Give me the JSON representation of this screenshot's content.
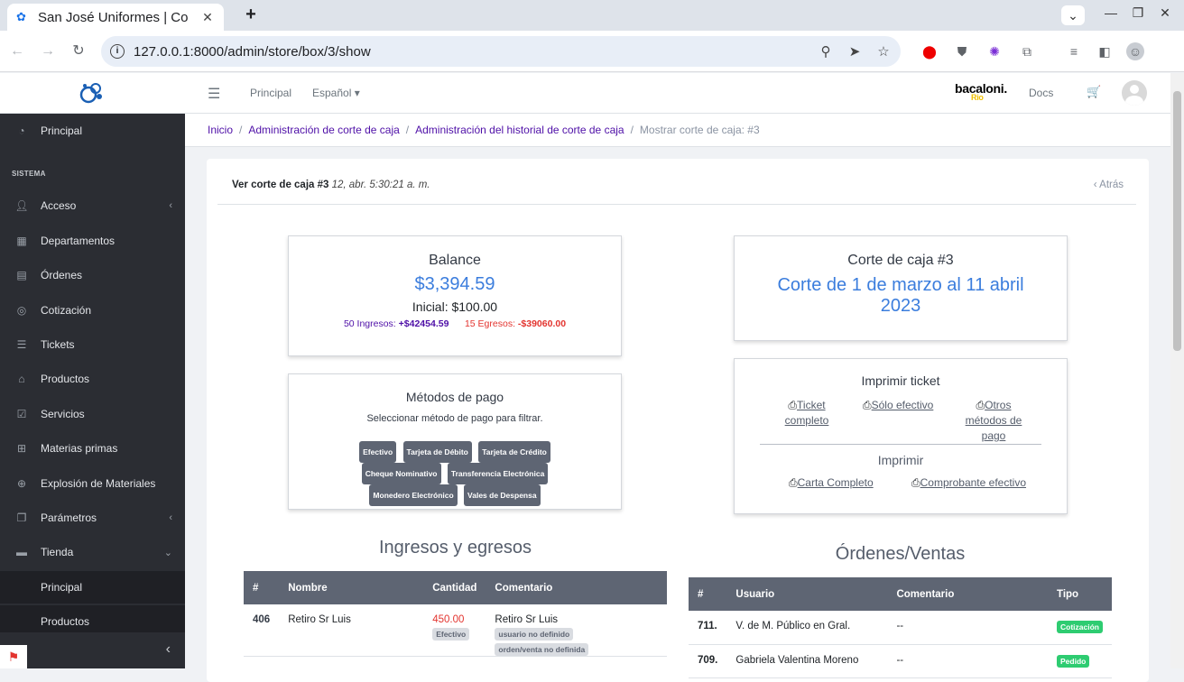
{
  "browser": {
    "tab_title": "San José Uniformes | Co",
    "url": "127.0.0.1:8000/admin/store/box/3/show"
  },
  "header": {
    "nav": [
      "Principal",
      "Español"
    ],
    "brand_name": "bacaloni",
    "brand_sub": "Rio",
    "docs": "Docs"
  },
  "sidebar": {
    "top_item": "Principal",
    "section": "SISTEMA",
    "items": [
      {
        "label": "Acceso",
        "icon": "user-icon",
        "has_arrow": true
      },
      {
        "label": "Departamentos",
        "icon": "grid-icon"
      },
      {
        "label": "Órdenes",
        "icon": "receipt-icon"
      },
      {
        "label": "Cotización",
        "icon": "target-icon"
      },
      {
        "label": "Tickets",
        "icon": "list-icon"
      },
      {
        "label": "Productos",
        "icon": "tag-icon"
      },
      {
        "label": "Servicios",
        "icon": "checklist-icon"
      },
      {
        "label": "Materias primas",
        "icon": "boxes-icon"
      },
      {
        "label": "Explosión de Materiales",
        "icon": "globe-icon"
      },
      {
        "label": "Parámetros",
        "icon": "copy-icon",
        "has_arrow": true
      },
      {
        "label": "Tienda",
        "icon": "store-icon",
        "expanded": true
      }
    ],
    "subitems": [
      "Principal",
      "Productos"
    ]
  },
  "breadcrumb": {
    "items": [
      "Inicio",
      "Administración de corte de caja",
      "Administración del historial de corte de caja"
    ],
    "current": "Mostrar corte de caja: #3"
  },
  "card": {
    "title": "Ver corte de caja #3",
    "date": "12, abr. 5:30:21 a. m.",
    "back": "Atrás"
  },
  "balance": {
    "title": "Balance",
    "amount": "$3,394.59",
    "initial_label": "Inicial:",
    "initial_value": "$100.00",
    "ingresos_label": "50 Ingresos:",
    "ingresos_value": "+$42454.59",
    "egresos_label": "15 Egresos:",
    "egresos_value": "-$39060.00"
  },
  "corte": {
    "title": "Corte de caja #3",
    "range": "Corte de 1 de marzo al 11 abril 2023"
  },
  "metodos": {
    "title": "Métodos de pago",
    "subtitle": "Seleccionar método de pago para filtrar.",
    "badges": [
      "Efectivo",
      "Tarjeta de Débito",
      "Tarjeta de Crédito",
      "Cheque Nominativo",
      "Transferencia Electrónica",
      "Monedero Electrónico",
      "Vales de Despensa"
    ]
  },
  "imprimir_ticket": {
    "title": "Imprimir ticket",
    "links": [
      "Ticket completo",
      "Sólo efectivo",
      "Otros métodos de pago"
    ],
    "title2": "Imprimir",
    "links2": [
      "Carta Completo",
      "Comprobante efectivo"
    ]
  },
  "ingresos": {
    "title": "Ingresos y egresos",
    "headers": [
      "#",
      "Nombre",
      "Cantidad",
      "Comentario"
    ],
    "rows": [
      {
        "id": "406",
        "nombre": "Retiro Sr Luis",
        "cantidad": "450.00",
        "metodo": "Efectivo",
        "comentario": "Retiro Sr Luis",
        "tag1": "usuario no definido",
        "tag2": "orden/venta no definida"
      }
    ]
  },
  "ordenes": {
    "title": "Órdenes/Ventas",
    "headers": [
      "#",
      "Usuario",
      "Comentario",
      "Tipo"
    ],
    "rows": [
      {
        "id": "711.",
        "usuario": "V. de M. Público en Gral.",
        "comentario": "--",
        "tipo": "Cotización"
      },
      {
        "id": "709.",
        "usuario": "Gabriela Valentina Moreno",
        "comentario": "--",
        "tipo": "Pedido"
      }
    ]
  },
  "colors": {
    "purple": "#4e0fa7",
    "red": "#e3342f",
    "blue": "#3b7ddd",
    "green": "#2ecc71"
  }
}
